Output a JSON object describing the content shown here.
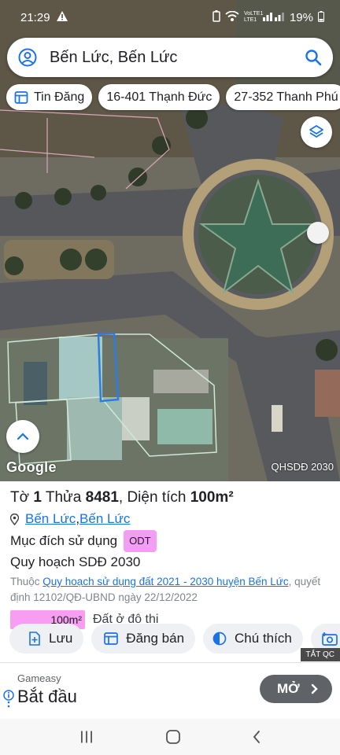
{
  "status": {
    "time": "21:29",
    "battery": "19%",
    "network": "VoLTE1 LTE1"
  },
  "search": {
    "text": "Bến Lức, Bến Lức"
  },
  "chips": [
    {
      "label": "Tin Đăng",
      "icon": "listing-icon"
    },
    {
      "label": "16-401 Thạnh Đức"
    },
    {
      "label": "27-352 Thanh Phú"
    }
  ],
  "map": {
    "watermark": "Google",
    "layer_label": "QHSDĐ 2030"
  },
  "parcel": {
    "prefix_sheet": "Tờ ",
    "sheet": "1",
    "prefix_lot": " Thửa ",
    "lot": "8481",
    "area_prefix": ", Diện tích ",
    "area": "100m²",
    "location_1": "Bến Lức",
    "location_sep": ", ",
    "location_2": "Bến Lức",
    "purpose_label": "Mục đích sử dụng",
    "purpose_code": "ODT",
    "plan_title": "Quy hoạch SDĐ 2030",
    "plan_prefix": "Thuộc ",
    "plan_link": "Quy hoạch sử dụng đất 2021 - 2030 huyện Bến Lức",
    "plan_decision": ", quyết định 12102/QĐ-UBND ngày 22/12/2022",
    "legend_value": "100m²",
    "legend_label": "Đất ở đô thị"
  },
  "actions": [
    {
      "label": "Lưu"
    },
    {
      "label": "Đăng bán"
    },
    {
      "label": "Chú thích"
    }
  ],
  "ad_close": "TẮT QC",
  "ad": {
    "brand": "Gameasy",
    "headline": "Bắt đầu",
    "button": "MỞ"
  },
  "colors": {
    "accent": "#1a73e8",
    "odt": "#f39df5",
    "legend": "#f79df2"
  }
}
